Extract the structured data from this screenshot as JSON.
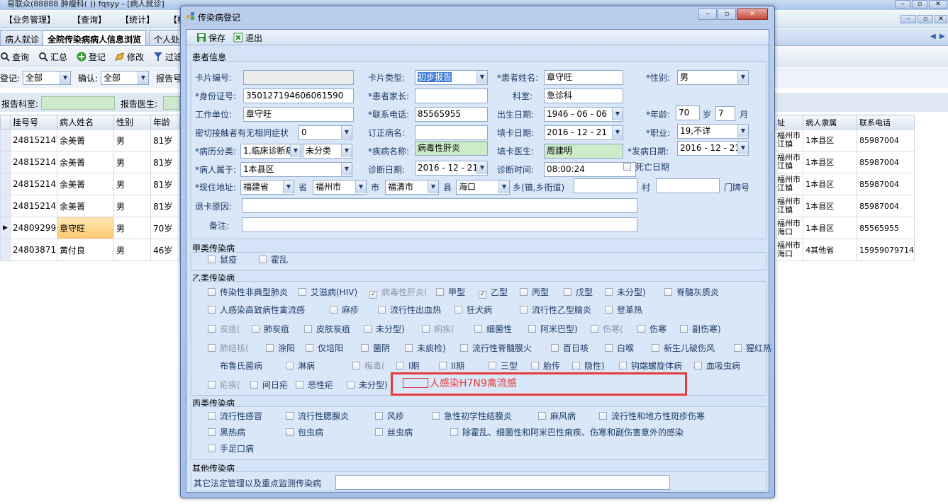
{
  "app": {
    "title": "易联众(88888 肿瘤科( )) fqsyy - [病人就诊]"
  },
  "menu": [
    "【业务管理】",
    "【查询】",
    "【统计】",
    "【模"
  ],
  "tabs": [
    "病人就诊",
    "全院传染病病人信息浏览",
    "个人处"
  ],
  "toolbar": {
    "query": "查询",
    "summary": "汇总",
    "register": "登记",
    "modify": "修改",
    "filter": "过滤"
  },
  "filters": {
    "register_label": "登记:",
    "register_value": "全部",
    "confirm_label": "确认:",
    "confirm_value": "全部",
    "report_no_label": "报告号",
    "dept_label": "报告科室:",
    "doctor_label": "报告医生:"
  },
  "grid": {
    "left_headers": [
      "挂号号",
      "病人姓名",
      "性别",
      "年龄"
    ],
    "right_headers": [
      "址",
      "病人隶属",
      "联系电话"
    ],
    "rows": [
      {
        "reg": "24815214",
        "name": "余美菁",
        "sex": "男",
        "age": "81岁",
        "addr": "福州市江镇",
        "belong": "1本县区",
        "phone": "85987004"
      },
      {
        "reg": "24815214",
        "name": "余美菁",
        "sex": "男",
        "age": "81岁",
        "addr": "福州市江镇",
        "belong": "1本县区",
        "phone": "85987004"
      },
      {
        "reg": "24815214",
        "name": "余美菁",
        "sex": "男",
        "age": "81岁",
        "addr": "福州市江镇",
        "belong": "1本县区",
        "phone": "85987004"
      },
      {
        "reg": "24815214",
        "name": "余美菁",
        "sex": "男",
        "age": "81岁",
        "addr": "福州市江镇",
        "belong": "1本县区",
        "phone": "85987004"
      },
      {
        "reg": "24809299",
        "name": "章守旺",
        "sex": "男",
        "age": "70岁",
        "addr": "福州市海口",
        "belong": "1本县区",
        "phone": "85565955"
      },
      {
        "reg": "24803871",
        "name": "黄付良",
        "sex": "男",
        "age": "46岁",
        "addr": "福州市海口",
        "belong": "4其他省",
        "phone": "15959079714"
      }
    ]
  },
  "dialog": {
    "title": "传染病登记",
    "save": "保存",
    "exit": "退出",
    "patient_group": "患者信息",
    "labels": {
      "card_no": "卡片编号:",
      "card_type": "卡片类型:",
      "patient_name": "*患者姓名:",
      "sex": "*性别:",
      "id_no": "*身份证号:",
      "guardian": "*患者家长:",
      "dept": "科室:",
      "work_unit": "工作单位:",
      "phone": "*联系电话:",
      "birth": "出生日期:",
      "age": "*年龄:",
      "age_unit1": "岁",
      "age_unit2": "月",
      "close_contact": "密切接触者有无相同症状",
      "revised": "订正病名:",
      "fill_date": "填卡日期:",
      "job": "*职业:",
      "case_type": "*病历分类:",
      "disease": "*疾病名称:",
      "fill_doctor": "填卡医生:",
      "onset": "*发病日期:",
      "belong": "*病人属于:",
      "diag_date": "诊断日期:",
      "diag_time": "诊断时间:",
      "death": "死亡日期",
      "addr": "*现住地址:",
      "province": "省",
      "city": "市",
      "county": "县",
      "town": "乡(镇,乡街道)",
      "village": "村",
      "door": "门牌号",
      "return_reason": "退卡原因:",
      "remark": "备注:"
    },
    "values": {
      "card_type": "初步报告",
      "patient_name": "章守旺",
      "sex": "男",
      "id_no": "350127194606061590",
      "dept": "急诊科",
      "work_unit": "章守旺",
      "phone": "85565955",
      "birth": "1946 - 06 - 06",
      "age": "70",
      "age_month": "7",
      "close_contact": "0",
      "fill_date": "2016 - 12 - 21",
      "job": "19,不详",
      "case_type_1": "1,临床诊断病",
      "case_type_2": "未分类",
      "disease": "病毒性肝炎",
      "fill_doctor": "周建明",
      "onset": "2016 - 12 - 21",
      "belong": "1本县区",
      "diag_date": "2016 - 12 - 21",
      "diag_time": "08:00:24",
      "province": "福建省",
      "city": "福州市",
      "county": "福清市",
      "town": "海口"
    },
    "class_a": {
      "title": "甲类传染病",
      "items": [
        "鼠疫",
        "霍乱"
      ]
    },
    "class_b": {
      "title": "乙类传染病",
      "row1": [
        "传染性非典型肺炎",
        "艾滋病(HIV)",
        "病毒性肝炎(",
        "甲型",
        "乙型",
        "丙型",
        "戊型",
        "未分型)",
        "脊髓灰质炎"
      ],
      "row2": [
        "人感染高致病性禽流感",
        "麻疹",
        "流行性出血热",
        "狂犬病",
        "流行性乙型脑炎",
        "登革热"
      ],
      "row3": [
        "炭疽(",
        "肺炭疽",
        "皮肤炭疽",
        "未分型)",
        "痢疾(",
        "细菌性",
        "阿米巴型)",
        "伤寒(",
        "伤寒",
        "副伤寒)"
      ],
      "row4": [
        "肺结核(",
        "涂阳",
        "仅培阳",
        "菌阴",
        "未痰检)",
        "流行性脊髓膜火",
        "百日咳",
        "白喉",
        "新生儿破伤风",
        "猩红热"
      ],
      "row5": [
        "布鲁氏菌病",
        "淋病",
        "梅毒(",
        "I期",
        "II期",
        "三型",
        "胎传",
        "隐性)",
        "钩端螺旋体病",
        "血吸虫病"
      ],
      "row6": [
        "疟疾(",
        "间日疟",
        "恶性疟",
        "未分型)"
      ],
      "h7n9": "人感染H7N9禽流感"
    },
    "class_c": {
      "title": "丙类传染病",
      "row1": [
        "流行性感冒",
        "流行性腮腺炎",
        "风疹",
        "急性初学性结膜炎",
        "麻风病",
        "流行性和地方性斑疹伤寒"
      ],
      "row2": [
        "黑热病",
        "包虫病",
        "丝虫病",
        "除霍乱、细菌性和阿米巴性痢疾、伤寒和副伤害意外的感染"
      ],
      "row3": [
        "手足口病"
      ]
    },
    "other": {
      "title": "其他传染病",
      "label": "其它法定管理以及重点监测传染病"
    }
  }
}
